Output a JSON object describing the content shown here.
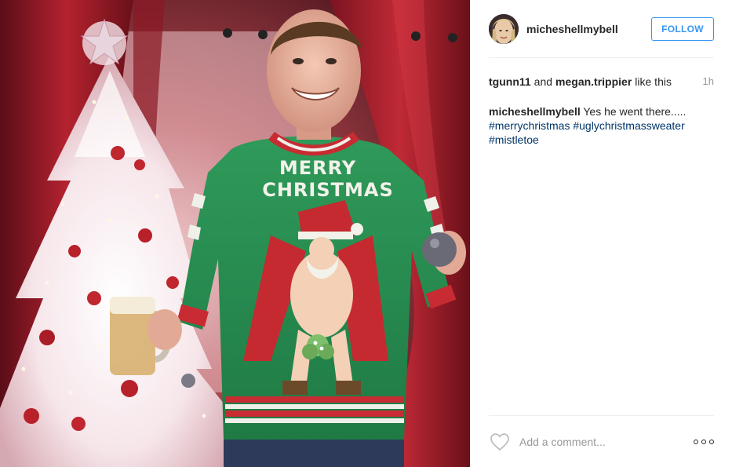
{
  "post": {
    "author": "micheshellmybell",
    "follow_label": "FOLLOW",
    "likes": {
      "user1": "tgunn11",
      "conjunction": "and",
      "user2": "megan.trippier",
      "suffix": "like this"
    },
    "time": "1h",
    "caption": {
      "author": "micheshellmybell",
      "text": "Yes he went there.....",
      "hashtags": [
        "#merrychristmas",
        "#uglychristmassweater",
        "#mistletoe"
      ]
    },
    "comment_placeholder": "Add a comment...",
    "photo": {
      "sweater_text_line1": "MERRY",
      "sweater_text_line2": "CHRISTMAS"
    }
  },
  "icons": {
    "like": "heart-icon",
    "more": "more-options-icon"
  },
  "colors": {
    "link": "#003569",
    "follow": "#3897f0",
    "text": "#262626",
    "muted": "#999999",
    "divider": "#efefef"
  }
}
